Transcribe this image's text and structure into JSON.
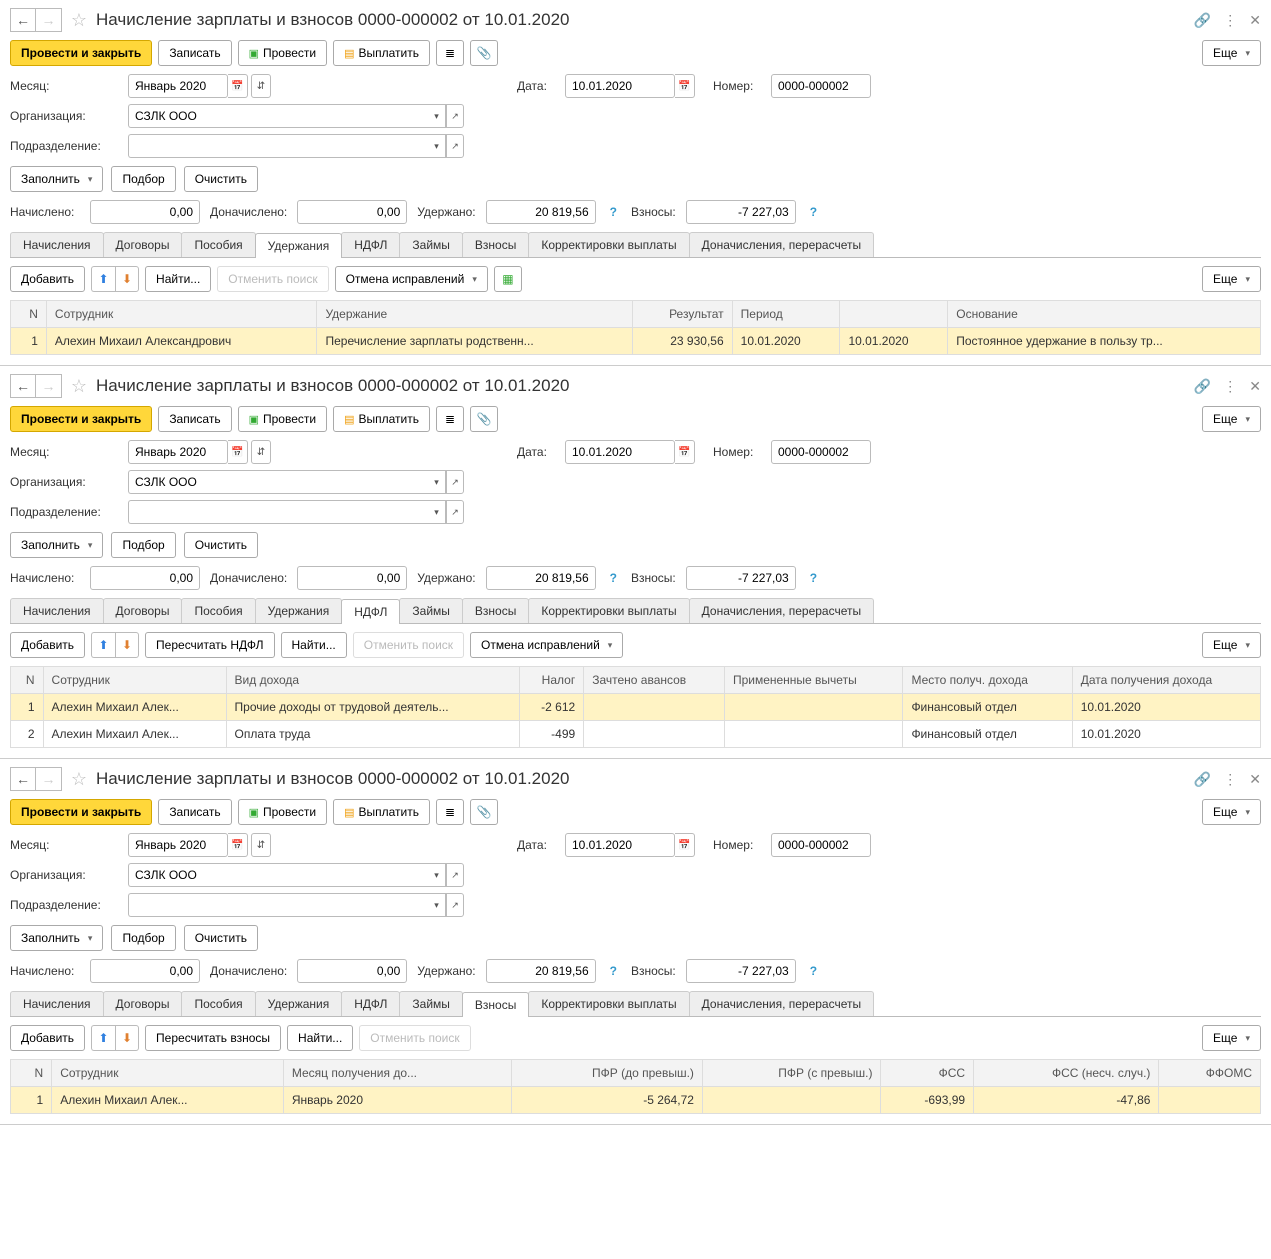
{
  "title": "Начисление зарплаты и взносов 0000-000002 от 10.01.2020",
  "toolbar": {
    "post_close": "Провести и закрыть",
    "save": "Записать",
    "post": "Провести",
    "pay": "Выплатить",
    "more": "Еще"
  },
  "form": {
    "month_label": "Месяц:",
    "month_value": "Январь 2020",
    "date_label": "Дата:",
    "date_value": "10.01.2020",
    "number_label": "Номер:",
    "number_value": "0000-000002",
    "org_label": "Организация:",
    "org_value": "СЗЛК ООО",
    "dept_label": "Подразделение:",
    "dept_value": ""
  },
  "actions": {
    "fill": "Заполнить",
    "pick": "Подбор",
    "clear": "Очистить"
  },
  "summary": {
    "accrued_label": "Начислено:",
    "accrued_value": "0,00",
    "extra_label": "Доначислено:",
    "extra_value": "0,00",
    "withheld_label": "Удержано:",
    "withheld_value": "20 819,56",
    "contrib_label": "Взносы:",
    "contrib_value": "-7 227,03"
  },
  "tabs": [
    "Начисления",
    "Договоры",
    "Пособия",
    "Удержания",
    "НДФЛ",
    "Займы",
    "Взносы",
    "Корректировки выплаты",
    "Доначисления, перерасчеты"
  ],
  "tab_toolbar": {
    "add": "Добавить",
    "find": "Найти...",
    "cancel_search": "Отменить поиск",
    "cancel_fix": "Отмена исправлений",
    "recalc_ndfl": "Пересчитать НДФЛ",
    "recalc_contrib": "Пересчитать взносы",
    "more": "Еще"
  },
  "panel1": {
    "active_tab": 3,
    "columns": [
      "N",
      "Сотрудник",
      "Удержание",
      "Результат",
      "Период",
      "",
      "Основание"
    ],
    "rows": [
      {
        "n": "1",
        "emp": "Алехин Михаил Александрович",
        "ded": "Перечисление зарплаты родственн...",
        "result": "23 930,56",
        "p1": "10.01.2020",
        "p2": "10.01.2020",
        "basis": "Постоянное удержание в пользу тр..."
      }
    ]
  },
  "panel2": {
    "active_tab": 4,
    "columns": [
      "N",
      "Сотрудник",
      "Вид дохода",
      "Налог",
      "Зачтено авансов",
      "Примененные вычеты",
      "Место получ. дохода",
      "Дата получения дохода"
    ],
    "rows": [
      {
        "n": "1",
        "emp": "Алехин Михаил Алек...",
        "kind": "Прочие доходы от трудовой деятель...",
        "tax": "-2 612",
        "adv": "",
        "ded": "",
        "place": "Финансовый отдел",
        "date": "10.01.2020",
        "sel": true
      },
      {
        "n": "2",
        "emp": "Алехин Михаил Алек...",
        "kind": "Оплата труда",
        "tax": "-499",
        "adv": "",
        "ded": "",
        "place": "Финансовый отдел",
        "date": "10.01.2020",
        "sel": false
      }
    ]
  },
  "panel3": {
    "active_tab": 6,
    "columns": [
      "N",
      "Сотрудник",
      "Месяц получения до...",
      "ПФР (до превыш.)",
      "ПФР (с превыш.)",
      "ФСС",
      "ФСС (несч. случ.)",
      "ФФОМС"
    ],
    "rows": [
      {
        "n": "1",
        "emp": "Алехин Михаил Алек...",
        "month": "Январь 2020",
        "pfr1": "-5 264,72",
        "pfr2": "",
        "fss": "-693,99",
        "fss_ns": "-47,86",
        "ffoms": ""
      }
    ]
  }
}
